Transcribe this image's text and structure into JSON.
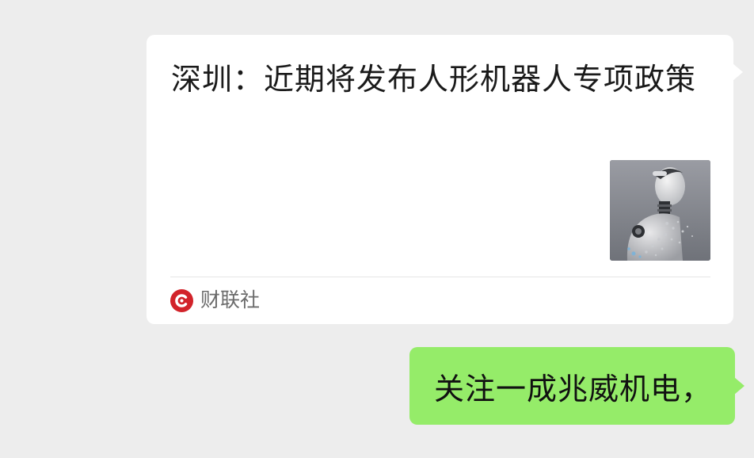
{
  "messages": {
    "link_card": {
      "title": "深圳：近期将发布人形机器人专项政策",
      "thumbnail_icon": "robot-thumbnail",
      "source": {
        "name": "财联社",
        "logo_icon": "cailianshe-logo-icon",
        "logo_color": "#d2232a"
      }
    },
    "outgoing_text": {
      "text": "关注一成兆威机电，",
      "bubble_color": "#95ec69"
    }
  },
  "colors": {
    "background": "#ededed",
    "card": "#ffffff"
  }
}
